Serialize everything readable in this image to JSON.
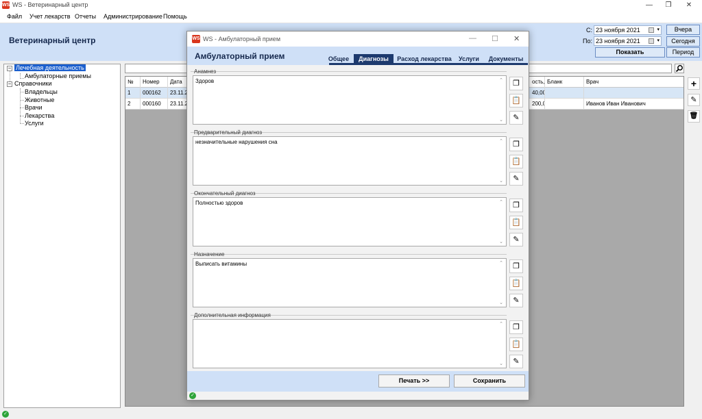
{
  "app": {
    "logo": "WS",
    "title": "WS - Ветеринарный центр",
    "controls": [
      "—",
      "❐",
      "✕"
    ]
  },
  "menu": [
    "Файл",
    "Учет лекарств",
    "Отчеты",
    "Администрирование",
    "Помощь"
  ],
  "header": {
    "title": "Ветеринарный центр",
    "from_label": "С:",
    "from_date": "23  ноября  2021",
    "to_label": "По:",
    "to_date": "23  ноября  2021",
    "btn_yesterday": "Вчера",
    "btn_today": "Сегодня",
    "btn_show": "Показать",
    "btn_period": "Период"
  },
  "tree": {
    "root1": "Лечебная деятельность",
    "child1": "Амбулаторные приемы",
    "root2": "Справочники",
    "children2": [
      "Владельцы",
      "Животные",
      "Врачи",
      "Лекарства",
      "Услуги"
    ]
  },
  "grid": {
    "headers": [
      "№",
      "Номер",
      "Дата",
      "ость,",
      "Бланк",
      "Врач"
    ],
    "rows": [
      [
        "1",
        "000162",
        "23.11.20",
        "40,00",
        "",
        ""
      ],
      [
        "2",
        "000160",
        "23.11.20",
        "200,00",
        "",
        "Иванов  Иван Иванович"
      ]
    ]
  },
  "side_buttons": [
    "+",
    "✎",
    "🗑"
  ],
  "modal": {
    "logo": "WS",
    "title": "WS - Амбулаторный прием",
    "header_title": "Амбулаторный прием",
    "tabs": [
      "Общее",
      "Диагнозы",
      "Расход лекарства",
      "Услуги",
      "Документы"
    ],
    "active_tab": "Диагнозы",
    "sections": [
      {
        "label": "Анамнез",
        "text": "Здоров"
      },
      {
        "label": "Предварительный диагноз",
        "text": "незначительные нарушения сна"
      },
      {
        "label": "Окончательный диагноз",
        "text": "Полностью здоров"
      },
      {
        "label": "Назначение",
        "text": "Выписать витамины"
      },
      {
        "label": "Дополнительная информация",
        "text": ""
      }
    ],
    "btn_print": "Печать  >>",
    "btn_save": "Сохранить",
    "status_ok": "✓"
  },
  "colors": {
    "header_bg": "#cfe0f7",
    "accent_dark": "#1d3a6e",
    "selection": "#1b5fce",
    "logo_red": "#d9361e",
    "ok_green": "#2ea43a"
  }
}
